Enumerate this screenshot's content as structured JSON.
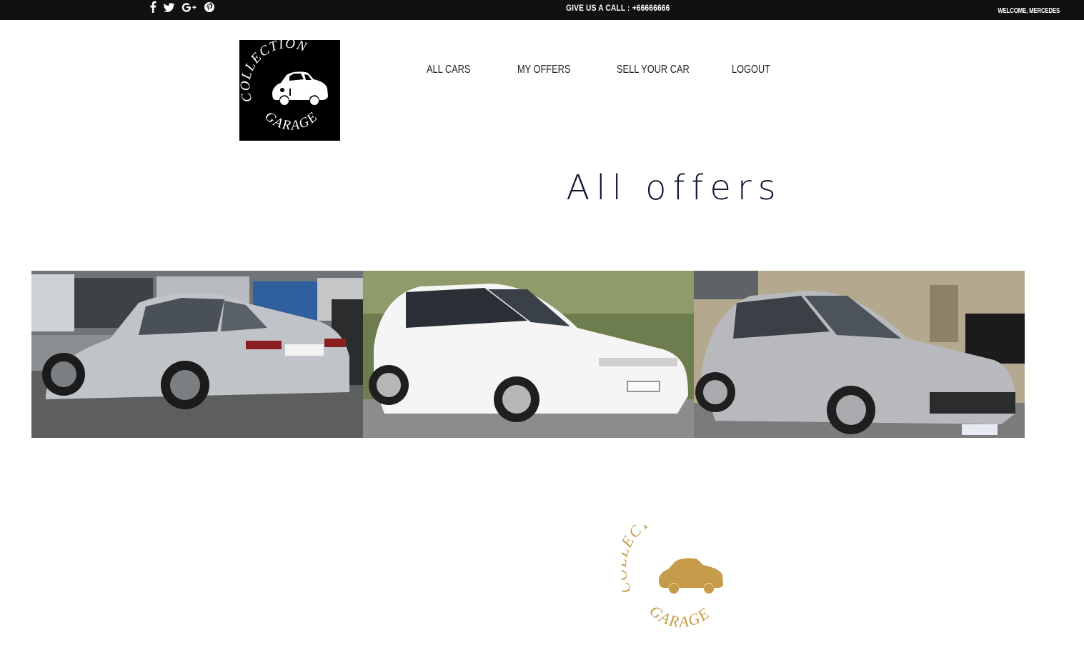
{
  "topbar": {
    "social": [
      "facebook-icon",
      "twitter-icon",
      "google-plus-icon",
      "pinterest-icon"
    ],
    "phone": "GIVE US A CALL : +66666666",
    "welcome": "WELCOME, MERCEDES"
  },
  "logo": {
    "text_top": "COLLECTION",
    "text_bottom": "GARAGE"
  },
  "nav": {
    "items": [
      {
        "label": "ALL CARS"
      },
      {
        "label": "MY OFFERS"
      },
      {
        "label": "SELL YOUR CAR"
      },
      {
        "label": "LOGOUT"
      }
    ]
  },
  "main": {
    "title": "All offers"
  },
  "offers": [
    {
      "image": "silver mercedes sedan rear view"
    },
    {
      "image": "white volkswagen golf hatchback"
    },
    {
      "image": "silver peugeot 207 hatchback"
    }
  ],
  "footer_logo": {
    "text_top": "COLLECTION",
    "text_bottom": "GARAGE",
    "color": "#c69b49"
  },
  "colors": {
    "topbar": "#111111",
    "title": "#0c1530",
    "gold": "#c69b49"
  }
}
